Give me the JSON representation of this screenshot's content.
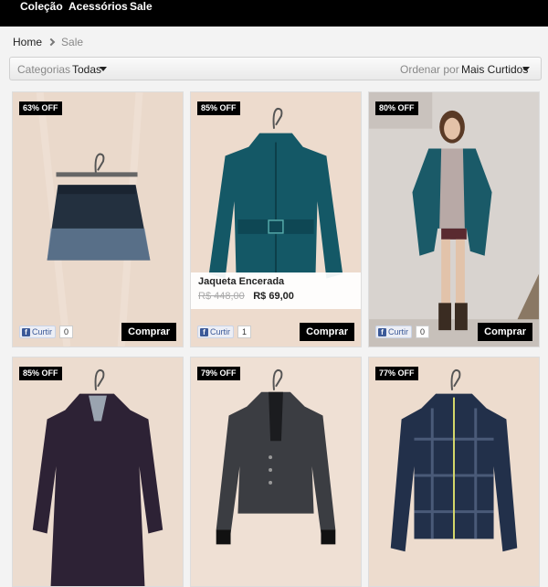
{
  "nav": {
    "items": [
      "Coleção",
      "Acessórios",
      "Sale"
    ]
  },
  "breadcrumb": {
    "home": "Home",
    "current": "Sale"
  },
  "filter": {
    "categories_label": "Categorias",
    "categories_value": "Todas",
    "sort_label": "Ordenar por",
    "sort_value": "Mais Curtidos"
  },
  "colors": {
    "nav_bg": "#000000",
    "badge_bg": "#000000",
    "facebook_blue": "#3b5998"
  },
  "products": [
    {
      "badge": "63% OFF",
      "image": "denim-skirt-on-hanger",
      "like_label": "Curtir",
      "likes": "0",
      "buy_label": "Comprar"
    },
    {
      "badge": "85% OFF",
      "image": "teal-waxed-jacket-on-hanger",
      "like_label": "Curtir",
      "likes": "1",
      "buy_label": "Comprar",
      "name": "Jaqueta Encerada",
      "old_price": "R$ 448,00",
      "new_price": "R$ 69,00"
    },
    {
      "badge": "80% OFF",
      "image": "model-wearing-teal-coat",
      "like_label": "Curtir",
      "likes": "0",
      "buy_label": "Comprar"
    },
    {
      "badge": "85% OFF",
      "image": "long-dark-coat-on-hanger"
    },
    {
      "badge": "79% OFF",
      "image": "grey-blazer-on-hanger"
    },
    {
      "badge": "77% OFF",
      "image": "plaid-zip-jacket-on-hanger"
    }
  ]
}
